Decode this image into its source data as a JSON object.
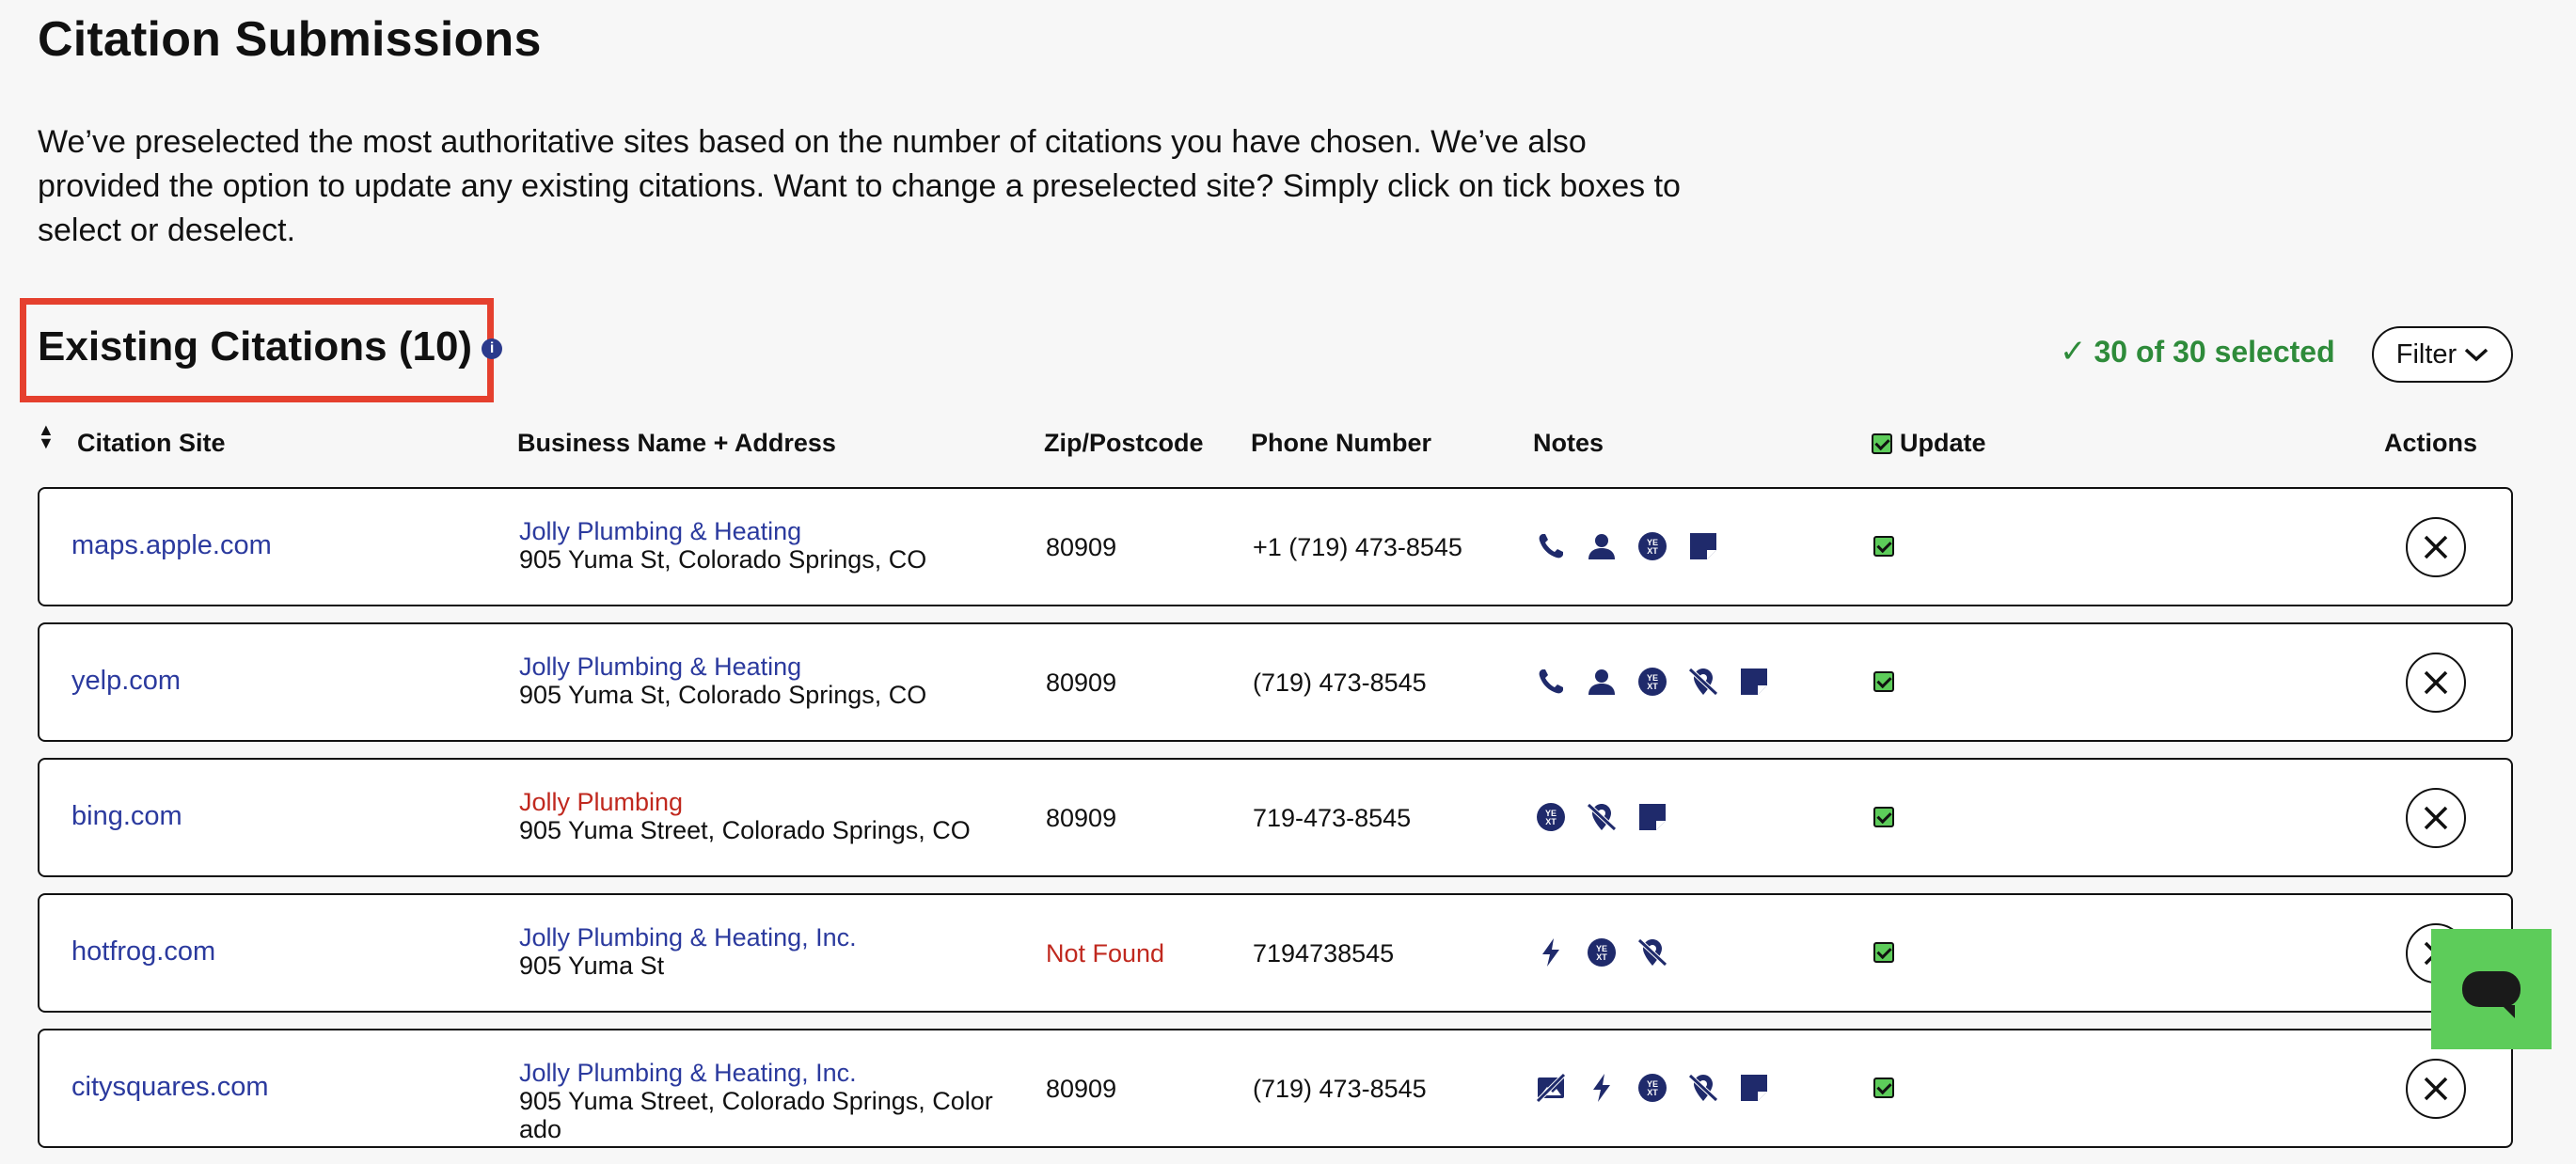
{
  "page": {
    "title": "Citation Submissions",
    "intro": "We’ve preselected the most authoritative sites based on the number of citations you have chosen. We’ve also provided the option to update any existing citations. Want to change a preselected site? Simply click on tick boxes to select or deselect."
  },
  "section": {
    "title": "Existing Citations (10)",
    "selected_text": "30 of 30 selected",
    "filter_label": "Filter"
  },
  "columns": {
    "site": "Citation Site",
    "business": "Business Name + Address",
    "zip": "Zip/Postcode",
    "phone": "Phone Number",
    "notes": "Notes",
    "update": "Update",
    "actions": "Actions"
  },
  "rows": [
    {
      "site": "maps.apple.com",
      "name": "Jolly Plumbing & Heating",
      "name_mismatch": false,
      "address": "905 Yuma St, Colorado Springs, CO",
      "zip": "80909",
      "zip_mismatch": false,
      "phone": "+1 (719) 473-8545",
      "notes": [
        "phone-icon",
        "user-icon",
        "yext-icon",
        "note-icon"
      ]
    },
    {
      "site": "yelp.com",
      "name": "Jolly Plumbing & Heating",
      "name_mismatch": false,
      "address": "905 Yuma St, Colorado Springs, CO",
      "zip": "80909",
      "zip_mismatch": false,
      "phone": "(719) 473-8545",
      "notes": [
        "phone-icon",
        "user-icon",
        "yext-icon",
        "no-location-icon",
        "note-icon"
      ]
    },
    {
      "site": "bing.com",
      "name": "Jolly Plumbing",
      "name_mismatch": true,
      "address": "905 Yuma Street, Colorado Springs, CO",
      "zip": "80909",
      "zip_mismatch": false,
      "phone": "719-473-8545",
      "notes": [
        "yext-icon",
        "no-location-icon",
        "note-icon"
      ]
    },
    {
      "site": "hotfrog.com",
      "name": "Jolly Plumbing & Heating, Inc.",
      "name_mismatch": false,
      "address": "905 Yuma St",
      "zip": "Not Found",
      "zip_mismatch": true,
      "phone": "7194738545",
      "notes": [
        "bolt-icon",
        "yext-icon",
        "no-location-icon"
      ]
    },
    {
      "site": "citysquares.com",
      "name": "Jolly Plumbing & Heating, Inc.",
      "name_mismatch": false,
      "address": "905 Yuma Street, Colorado Springs, Color ado",
      "zip": "80909",
      "zip_mismatch": false,
      "phone": "(719) 473-8545",
      "notes": [
        "no-image-icon",
        "bolt-icon",
        "yext-icon",
        "no-location-icon",
        "note-icon"
      ]
    }
  ],
  "colors": {
    "accent_blue": "#2b3a9e",
    "icon_navy": "#1f2a6b",
    "mismatch_red": "#c0281e",
    "selected_green": "#2e8b3a",
    "check_green": "#5dcc5a",
    "highlight_red": "#e5402e"
  }
}
